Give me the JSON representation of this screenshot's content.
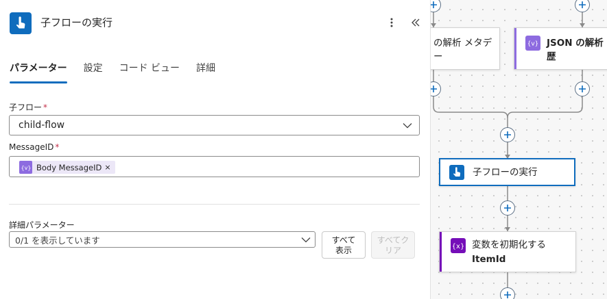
{
  "panel": {
    "title": "子フローの実行",
    "tabs": [
      {
        "label": "パラメーター",
        "active": true
      },
      {
        "label": "設定"
      },
      {
        "label": "コード ビュー"
      },
      {
        "label": "詳細"
      }
    ],
    "fields": {
      "child_flow": {
        "label": "子フロー",
        "required_mark": "*",
        "value": "child-flow"
      },
      "message_id": {
        "label": "MessageID",
        "required_mark": "*",
        "token": "Body MessageID",
        "token_close": "×"
      }
    },
    "advanced": {
      "label": "詳細パラメーター",
      "select_value": "0/1 を表示しています",
      "show_all": [
        "すべて",
        "表示"
      ],
      "clear_all": [
        "すべてク",
        "リア"
      ]
    }
  },
  "canvas": {
    "nodes": {
      "parse_metadata": "の解析 メタデー",
      "parse_json": [
        "JSON の解析 C",
        "歴"
      ],
      "run_child": "子フローの実行",
      "init_var": [
        "変数を初期化する",
        "ItemId"
      ]
    }
  },
  "colors": {
    "accent": "#0f6cbd",
    "variable_purple": "#750eb8",
    "json_purple": "#8d6be0"
  },
  "icons": {
    "header": "touch-hand-icon",
    "more": "more-vertical-icon",
    "collapse": "double-chevron-left-icon",
    "select": "chevron-down-icon",
    "token": "expression-icon",
    "add": "plus-icon"
  }
}
